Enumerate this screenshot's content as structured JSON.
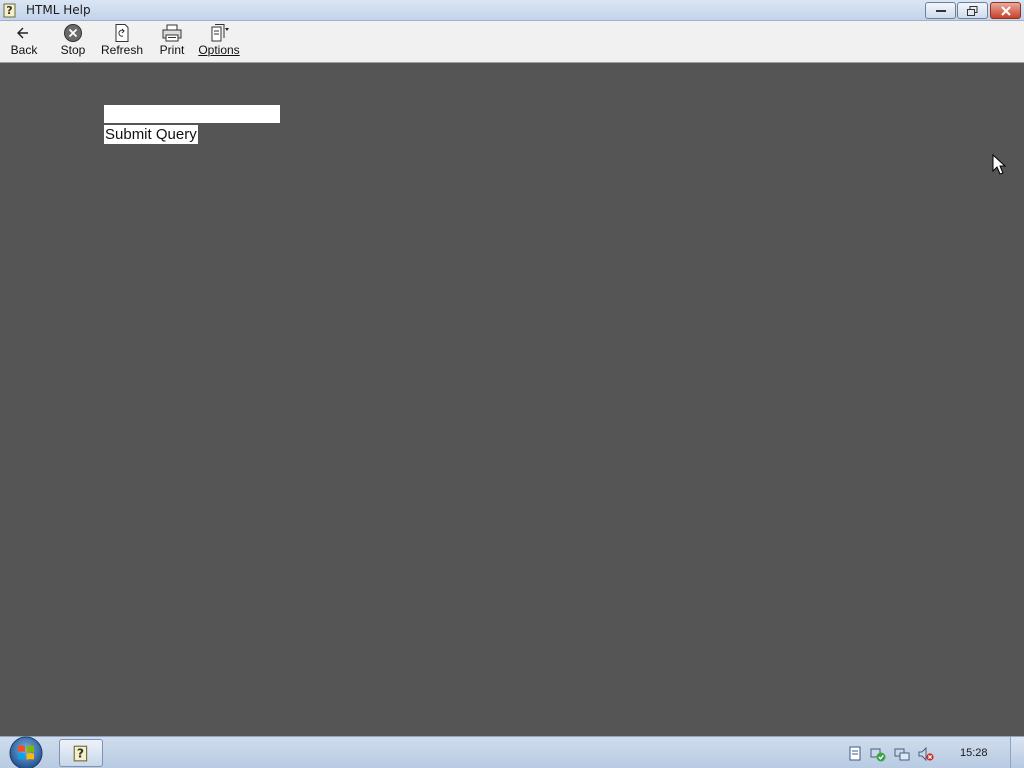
{
  "window": {
    "title": "HTML Help",
    "icon": "help-question-icon"
  },
  "toolbar": {
    "buttons": [
      {
        "label": "Back",
        "icon": "back-arrow-icon"
      },
      {
        "label": "Stop",
        "icon": "stop-icon"
      },
      {
        "label": "Refresh",
        "icon": "refresh-icon"
      },
      {
        "label": "Print",
        "icon": "printer-icon"
      },
      {
        "label": "Options",
        "icon": "options-icon"
      }
    ]
  },
  "content": {
    "background_color": "#555555",
    "search_value": "",
    "submit_label": "Submit Query"
  },
  "taskbar": {
    "clock": "15:28",
    "tray_icons": [
      "notes-icon",
      "security-check-icon",
      "network-icon",
      "volume-muted-icon"
    ]
  }
}
